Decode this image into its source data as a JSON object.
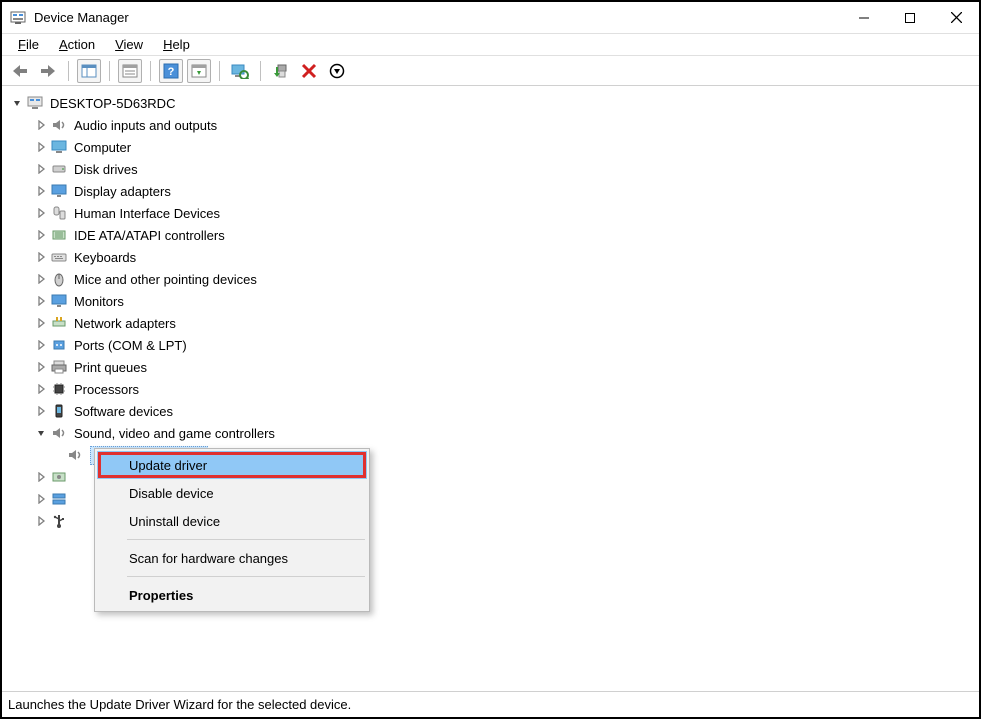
{
  "window": {
    "title": "Device Manager"
  },
  "menubar": {
    "items": [
      {
        "label": "File",
        "mn": "F"
      },
      {
        "label": "Action",
        "mn": "A"
      },
      {
        "label": "View",
        "mn": "V"
      },
      {
        "label": "Help",
        "mn": "H"
      }
    ]
  },
  "tree": {
    "root": {
      "label": "DESKTOP-5D63RDC"
    },
    "categories": [
      {
        "label": "Audio inputs and outputs",
        "icon": "audio"
      },
      {
        "label": "Computer",
        "icon": "computer"
      },
      {
        "label": "Disk drives",
        "icon": "disk"
      },
      {
        "label": "Display adapters",
        "icon": "display"
      },
      {
        "label": "Human Interface Devices",
        "icon": "hid"
      },
      {
        "label": "IDE ATA/ATAPI controllers",
        "icon": "ide"
      },
      {
        "label": "Keyboards",
        "icon": "keyboard"
      },
      {
        "label": "Mice and other pointing devices",
        "icon": "mouse"
      },
      {
        "label": "Monitors",
        "icon": "monitor"
      },
      {
        "label": "Network adapters",
        "icon": "network"
      },
      {
        "label": "Ports (COM & LPT)",
        "icon": "port"
      },
      {
        "label": "Print queues",
        "icon": "printer"
      },
      {
        "label": "Processors",
        "icon": "cpu"
      },
      {
        "label": "Software devices",
        "icon": "software"
      },
      {
        "label": "Sound, video and game controllers",
        "icon": "sound"
      }
    ],
    "extra_children": [
      {
        "icon": "system"
      },
      {
        "icon": "storage"
      },
      {
        "icon": "usb"
      }
    ]
  },
  "context_menu": {
    "items": [
      {
        "label": "Update driver",
        "highlight": true
      },
      {
        "label": "Disable device"
      },
      {
        "label": "Uninstall device"
      }
    ],
    "items2": [
      {
        "label": "Scan for hardware changes"
      }
    ],
    "items3": [
      {
        "label": "Properties",
        "bold": true
      }
    ]
  },
  "statusbar": {
    "text": "Launches the Update Driver Wizard for the selected device."
  }
}
